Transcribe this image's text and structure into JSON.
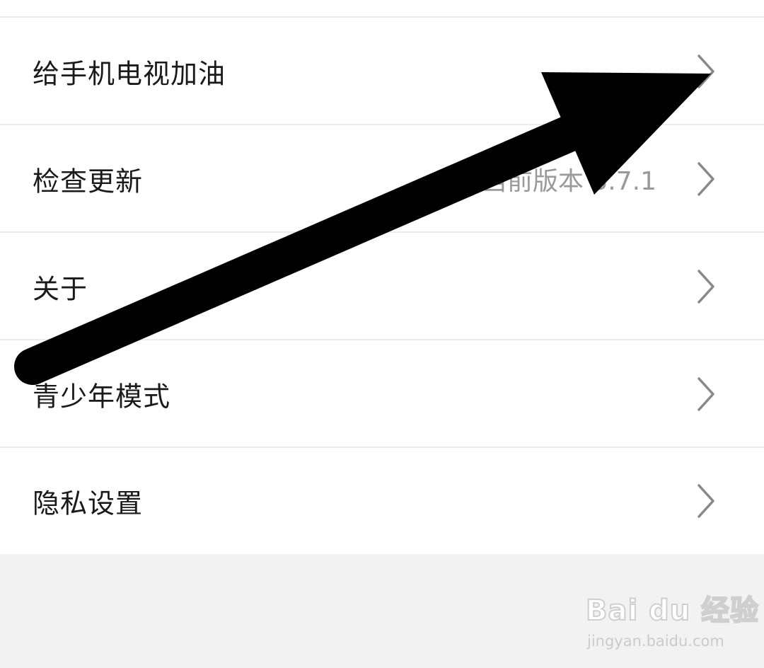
{
  "settings_list": {
    "items": [
      {
        "label": "给手机电视加油",
        "value": ""
      },
      {
        "label": "检查更新",
        "value": "当前版本 3.7.1"
      },
      {
        "label": "关于",
        "value": ""
      },
      {
        "label": "青少年模式",
        "value": ""
      },
      {
        "label": "隐私设置",
        "value": ""
      }
    ]
  },
  "icons": {
    "row_chevron": "chevron-right-icon",
    "annotation": "arrow-annotation-icon"
  },
  "watermark": {
    "brand": "Bai du 经验",
    "url": "jingyan.baidu.com"
  },
  "colors": {
    "list_bg": "#ffffff",
    "page_bg": "#f2f2f2",
    "label_text": "#1a1a1a",
    "value_text": "#9a9a9a",
    "chevron": "#888888",
    "arrow": "#000000"
  }
}
